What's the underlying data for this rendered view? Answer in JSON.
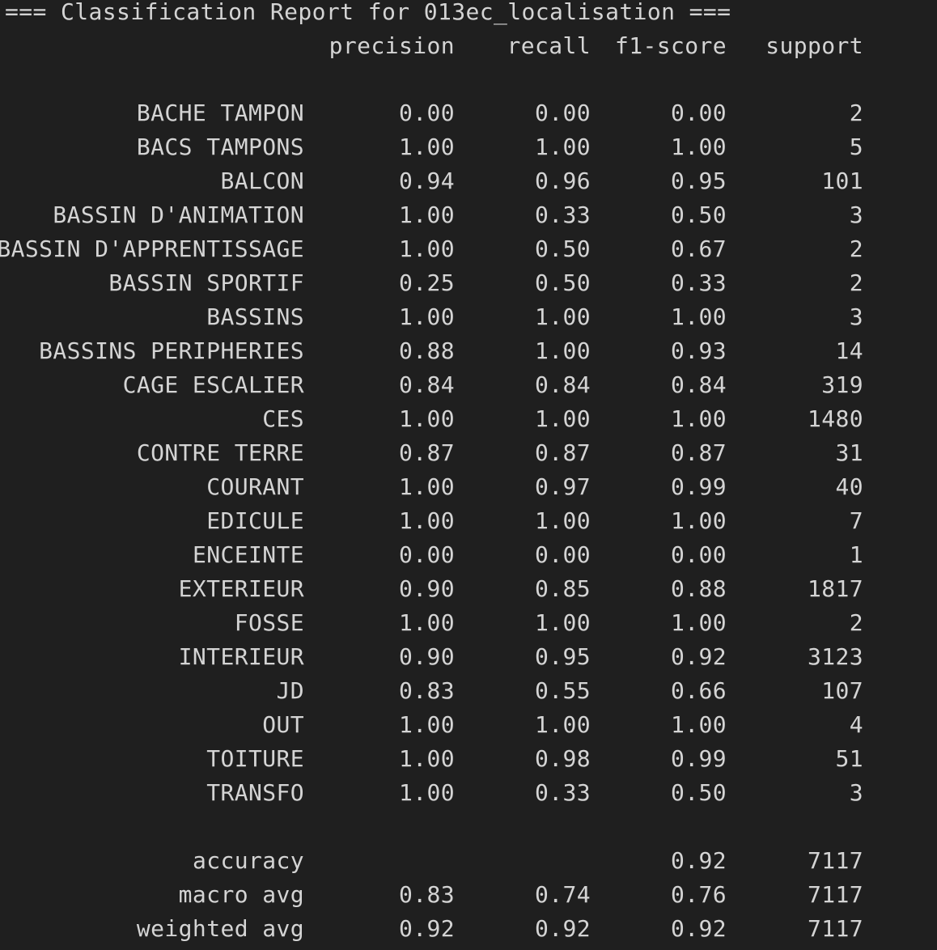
{
  "title": "=== Classification Report for 013ec_localisation ===",
  "headers": {
    "precision": "precision",
    "recall": "recall",
    "f1": "f1-score",
    "support": "support"
  },
  "rows": [
    {
      "label": "BACHE TAMPON",
      "precision": "0.00",
      "recall": "0.00",
      "f1": "0.00",
      "support": "2"
    },
    {
      "label": "BACS TAMPONS",
      "precision": "1.00",
      "recall": "1.00",
      "f1": "1.00",
      "support": "5"
    },
    {
      "label": "BALCON",
      "precision": "0.94",
      "recall": "0.96",
      "f1": "0.95",
      "support": "101"
    },
    {
      "label": "BASSIN D'ANIMATION",
      "precision": "1.00",
      "recall": "0.33",
      "f1": "0.50",
      "support": "3"
    },
    {
      "label": "BASSIN D'APPRENTISSAGE",
      "precision": "1.00",
      "recall": "0.50",
      "f1": "0.67",
      "support": "2"
    },
    {
      "label": "BASSIN SPORTIF",
      "precision": "0.25",
      "recall": "0.50",
      "f1": "0.33",
      "support": "2"
    },
    {
      "label": "BASSINS",
      "precision": "1.00",
      "recall": "1.00",
      "f1": "1.00",
      "support": "3"
    },
    {
      "label": "BASSINS PERIPHERIES",
      "precision": "0.88",
      "recall": "1.00",
      "f1": "0.93",
      "support": "14"
    },
    {
      "label": "CAGE ESCALIER",
      "precision": "0.84",
      "recall": "0.84",
      "f1": "0.84",
      "support": "319"
    },
    {
      "label": "CES",
      "precision": "1.00",
      "recall": "1.00",
      "f1": "1.00",
      "support": "1480"
    },
    {
      "label": "CONTRE TERRE",
      "precision": "0.87",
      "recall": "0.87",
      "f1": "0.87",
      "support": "31"
    },
    {
      "label": "COURANT",
      "precision": "1.00",
      "recall": "0.97",
      "f1": "0.99",
      "support": "40"
    },
    {
      "label": "EDICULE",
      "precision": "1.00",
      "recall": "1.00",
      "f1": "1.00",
      "support": "7"
    },
    {
      "label": "ENCEINTE",
      "precision": "0.00",
      "recall": "0.00",
      "f1": "0.00",
      "support": "1"
    },
    {
      "label": "EXTERIEUR",
      "precision": "0.90",
      "recall": "0.85",
      "f1": "0.88",
      "support": "1817"
    },
    {
      "label": "FOSSE",
      "precision": "1.00",
      "recall": "1.00",
      "f1": "1.00",
      "support": "2"
    },
    {
      "label": "INTERIEUR",
      "precision": "0.90",
      "recall": "0.95",
      "f1": "0.92",
      "support": "3123"
    },
    {
      "label": "JD",
      "precision": "0.83",
      "recall": "0.55",
      "f1": "0.66",
      "support": "107"
    },
    {
      "label": "OUT",
      "precision": "1.00",
      "recall": "1.00",
      "f1": "1.00",
      "support": "4"
    },
    {
      "label": "TOITURE",
      "precision": "1.00",
      "recall": "0.98",
      "f1": "0.99",
      "support": "51"
    },
    {
      "label": "TRANSFO",
      "precision": "1.00",
      "recall": "0.33",
      "f1": "0.50",
      "support": "3"
    }
  ],
  "summary": {
    "accuracy": {
      "label": "accuracy",
      "precision": "",
      "recall": "",
      "f1": "0.92",
      "support": "7117"
    },
    "macro": {
      "label": "macro avg",
      "precision": "0.83",
      "recall": "0.74",
      "f1": "0.76",
      "support": "7117"
    },
    "weighted": {
      "label": "weighted avg",
      "precision": "0.92",
      "recall": "0.92",
      "f1": "0.92",
      "support": "7117"
    }
  }
}
